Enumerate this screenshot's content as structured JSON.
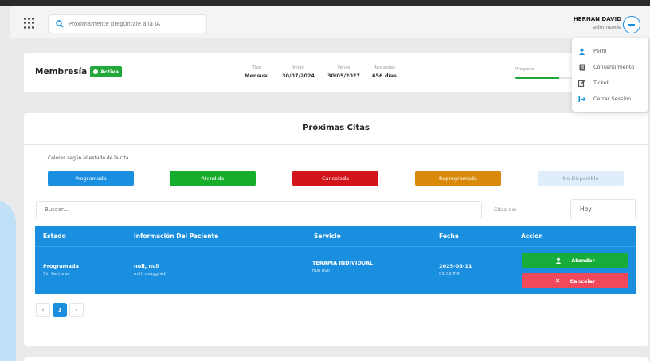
{
  "header": {
    "search_placeholder": "Próximamente pregúntale a la IA",
    "user_name": "HERNAN DAVID",
    "user_role": "adminsede"
  },
  "user_menu": {
    "items": [
      {
        "label": "Perfil",
        "icon": "user-icon"
      },
      {
        "label": "Consentimiento",
        "icon": "document-icon"
      },
      {
        "label": "Ticket",
        "icon": "edit-icon"
      },
      {
        "label": "Cerrar Session",
        "icon": "logout-icon"
      }
    ]
  },
  "membership": {
    "title": "Membresía",
    "status": "Activa",
    "tipo_label": "Tipo",
    "tipo_value": "Mensual",
    "inicio_label": "Inicio",
    "inicio_value": "30/07/2024",
    "vence_label": "Vence",
    "vence_value": "30/05/2027",
    "restantes_label": "Restantes",
    "restantes_value": "656 días",
    "progress_label": "Progreso",
    "progress_fraction": 0.55
  },
  "citas": {
    "title": "Próximas Citas",
    "colors_label": "Colores según el estado de la cita",
    "chips": [
      {
        "label": "Programada",
        "color": "#1a8fe0"
      },
      {
        "label": "Atendida",
        "color": "#16ad2a"
      },
      {
        "label": "Cancelada",
        "color": "#d3141a"
      },
      {
        "label": "Reprogramada",
        "color": "#d98a0a"
      },
      {
        "label": "No Disponible",
        "color": "#dfeefa"
      }
    ],
    "filter_placeholder": "Buscar...",
    "citas_de_label": "Citas de:",
    "date_value": "Hoy",
    "columns": [
      "Estado",
      "Información Del Paciente",
      "Servicio",
      "Fecha",
      "Accion"
    ],
    "rows": [
      {
        "estado": "Programada",
        "estado_sub": "Sin Facturar",
        "paciente": "null, null",
        "paciente_sub": "null: dsagghfdf",
        "servicio": "TERAPIA INDIVIDUAL",
        "servicio_sub": "null null",
        "fecha": "2025-08-11",
        "hora": "01:02 PM",
        "atender_label": "Atender",
        "cancelar_label": "Cancelar"
      }
    ],
    "pager": {
      "prev": "‹",
      "current": "1",
      "next": "›"
    }
  },
  "colors": {
    "primary": "#1a8fe0",
    "success": "#22a83a",
    "danger": "#f04a5a"
  }
}
